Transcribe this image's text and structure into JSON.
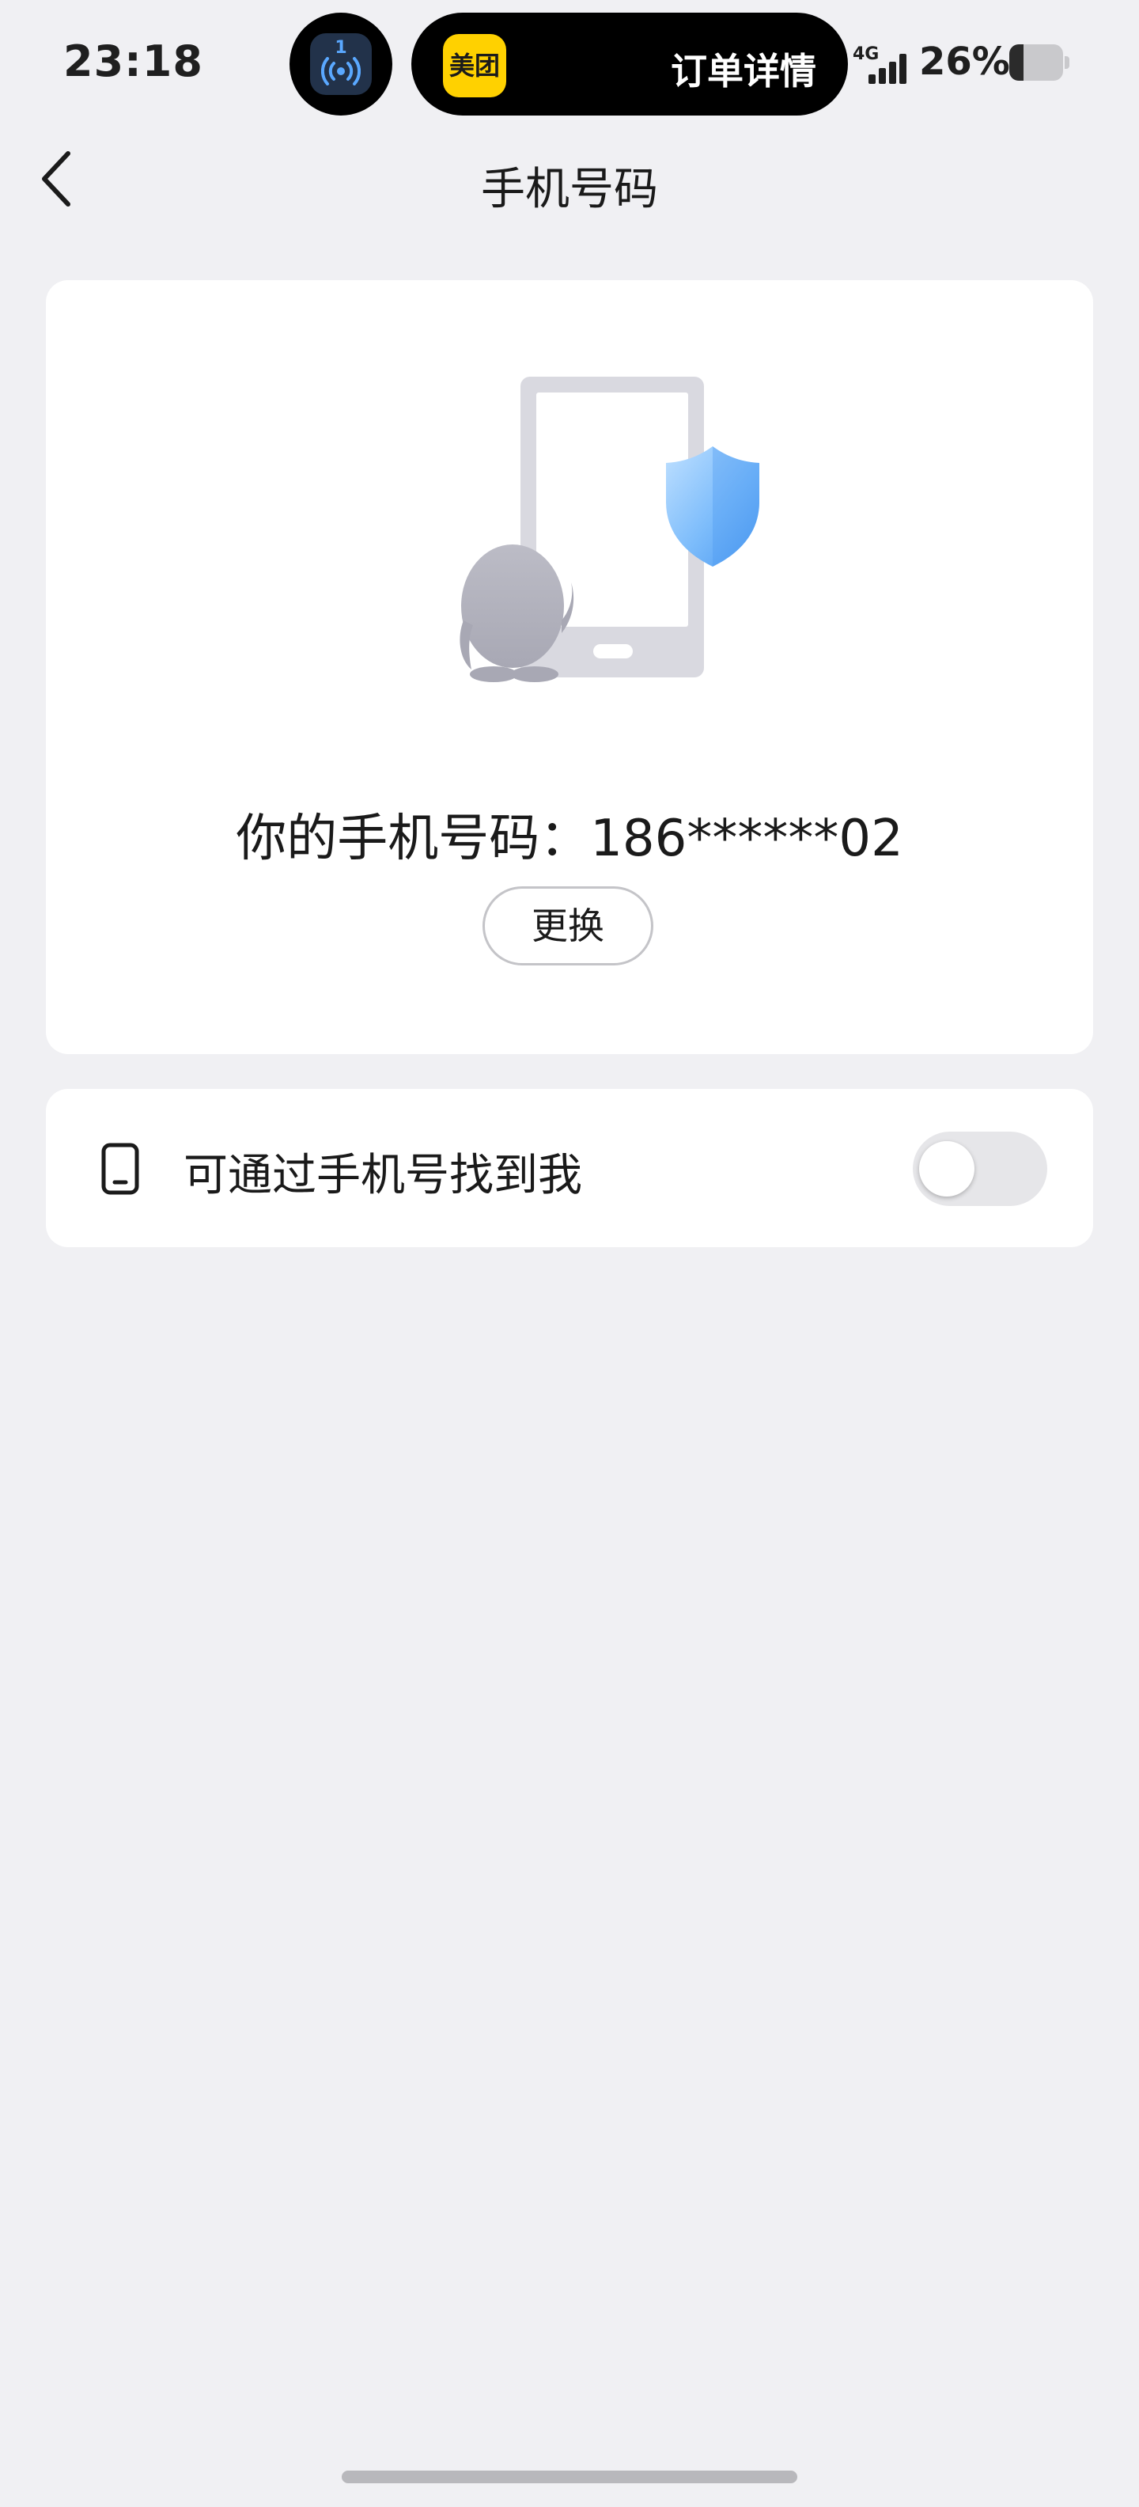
{
  "status_bar": {
    "time": "23:18",
    "live_activity_badge": "1",
    "live_activity_app": "美团",
    "live_activity_title": "订单详情",
    "network": "4G",
    "signal_bars": 4,
    "battery_percent_text": "26%",
    "battery_level": 0.26,
    "icons": [
      "broadcast-icon",
      "signal-icon",
      "battery-icon"
    ]
  },
  "nav": {
    "title": "手机号码",
    "back_icon": "chevron-left-icon"
  },
  "phone_card": {
    "illustration": "phone-penguin-shield-illustration",
    "phone_label": "你的手机号码：",
    "phone_number": "186******02",
    "change_button_label": "更换"
  },
  "settings": {
    "find_by_phone": {
      "icon": "phone-icon",
      "label": "可通过手机号找到我",
      "enabled": false
    }
  },
  "colors": {
    "page_background": "#f0f0f3",
    "card_background": "#ffffff",
    "meituan_yellow": "#ffd100",
    "shield_blue": "#5aa8f5",
    "toggle_off": "#e6e6e9"
  }
}
